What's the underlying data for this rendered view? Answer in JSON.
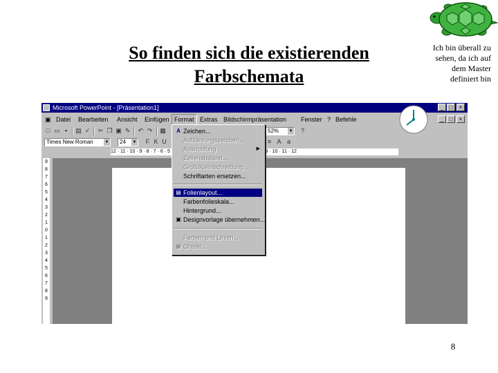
{
  "slide": {
    "title_line1": "So finden sich die existierenden",
    "title_line2": "Farbschemata",
    "master_note": "Ich bin überall zu sehen, da ich auf dem Master definiert bin",
    "page_number": "8"
  },
  "window": {
    "title": "Microsoft PowerPoint - [Präsentation1]",
    "minimize": "_",
    "maximize": "□",
    "close": "×"
  },
  "menubar": [
    "Datei",
    "Bearbeiten",
    "Ansicht",
    "Einfügen",
    "Format",
    "Extras",
    "Bildschirmpräsentation",
    "Fenster",
    "?",
    "Befehle"
  ],
  "toolbar": {
    "font_name": "Times New Roman",
    "font_size": "24",
    "zoom": "52%"
  },
  "ruler_h": "12 · 11 · 10 · 9 · 8 · 7 · 6 · 5 · 4 · 3 · 2 · 1 · 0 · 1 · 2 · 3 · 4 · 5 · 6 · 7 · 8 · 9 · 10 · 11 · 12",
  "ruler_v": [
    "9",
    "8",
    "7",
    "6",
    "5",
    "4",
    "3",
    "2",
    "1",
    "0",
    "1",
    "2",
    "3",
    "4",
    "5",
    "6",
    "7",
    "8",
    "9"
  ],
  "format_menu": {
    "items": [
      {
        "label": "Zeichen...",
        "state": "normal",
        "icon": "A"
      },
      {
        "label": "Aufzählungszeichen...",
        "state": "disabled",
        "icon": ""
      },
      {
        "label": "Ausrichtung",
        "state": "disabled",
        "icon": ""
      },
      {
        "label": "Zeilenabstand...",
        "state": "disabled",
        "icon": ""
      },
      {
        "label": "Groß/Kleinschreibung...",
        "state": "disabled",
        "icon": ""
      },
      {
        "label": "Schriftarten ersetzen...",
        "state": "normal",
        "icon": ""
      },
      {
        "label": "Folienlayout...",
        "state": "highlight",
        "icon": "▤"
      },
      {
        "label": "Farbenfolieskala...",
        "state": "normal",
        "icon": ""
      },
      {
        "label": "Hintergrund...",
        "state": "normal",
        "icon": ""
      },
      {
        "label": "Designvorlage übernehmen...",
        "state": "normal",
        "icon": "▣"
      },
      {
        "label": "Farben und Linien...",
        "state": "disabled",
        "icon": ""
      },
      {
        "label": "Objekt...",
        "state": "disabled",
        "icon": "▦"
      }
    ]
  },
  "colors": {
    "titlebar": "#000080",
    "highlight": "#000080",
    "workspace": "#808080",
    "turtle_shell": "#2e9e2e"
  }
}
